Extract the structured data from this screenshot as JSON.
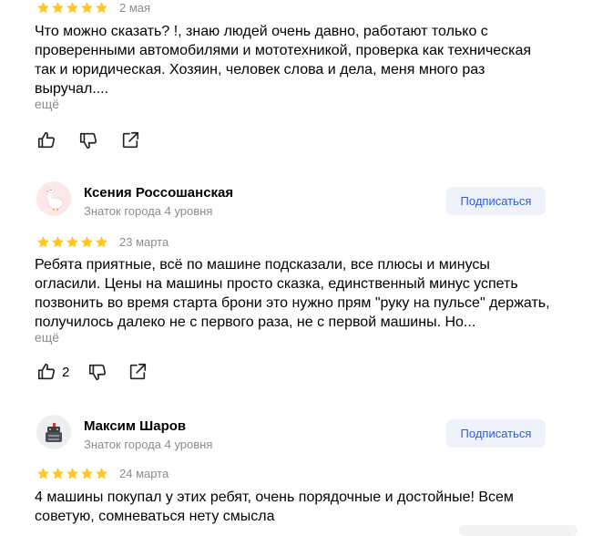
{
  "reviews": [
    {
      "author": null,
      "rating": 5,
      "date": "2 мая",
      "text": "Что можно сказать? !, знаю людей очень давно, работают только с проверенными автомобилями и мототехникой, проверка как техническая так и юридическая. Хозяин, человек слова и дела, меня много раз выручал....",
      "more": "ещё",
      "likes": ""
    },
    {
      "author": "Ксения Россошанская",
      "level": "Знаток города 4 уровня",
      "subscribe": "Подписаться",
      "avatar_icon": "goose-avatar-icon",
      "rating": 5,
      "date": "23 марта",
      "text": "Ребята приятные, всё по машине подсказали, все плюсы и минусы огласили. Цены на машины просто сказка, единственный минус успеть позвонить во время старта брони это нужно прям \"руку на пульсе\" держать, получилось далеко не с первого раза, не с первой машины. Но...",
      "more": "ещё",
      "likes": "2"
    },
    {
      "author": "Максим Шаров",
      "level": "Знаток города 4 уровня",
      "subscribe": "Подписаться",
      "avatar_icon": "robot-avatar-icon",
      "rating": 5,
      "date": "24 марта",
      "text": "4 машины покупал у этих ребят, очень порядочные и достойные! Всем советую, сомневаться нету смысла"
    }
  ],
  "colors": {
    "star": "#fcc82f",
    "accent": "#2f5cd9",
    "muted": "#8c8c8c",
    "subscribe_bg": "#eef2fa"
  }
}
